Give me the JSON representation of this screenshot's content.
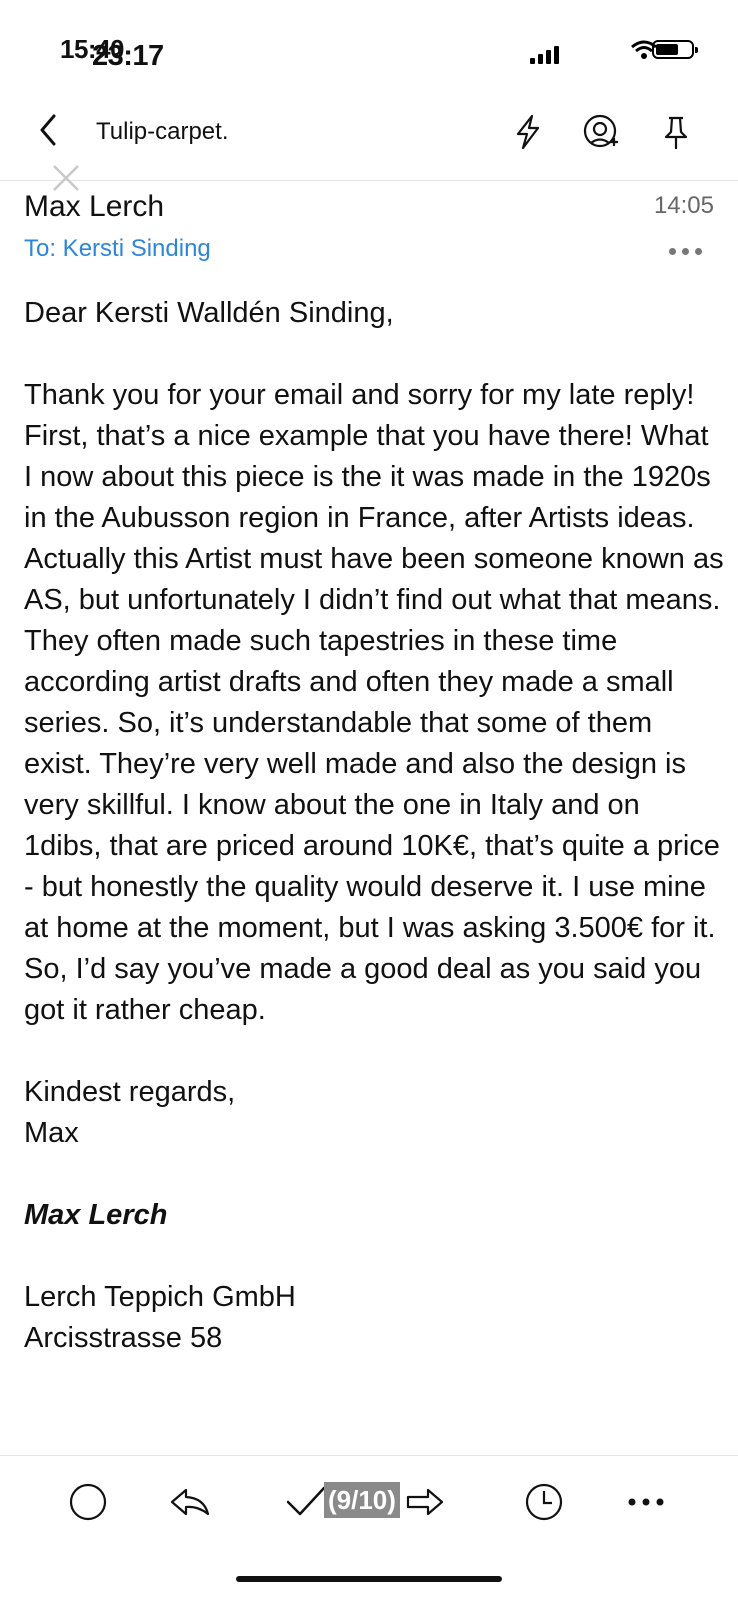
{
  "status_bar": {
    "time_overlap": "15:40",
    "time": "23:17"
  },
  "nav": {
    "title": "Tulip-carpet.",
    "icons": [
      "back-icon",
      "lightning-icon",
      "mention-add-icon",
      "pin-icon"
    ]
  },
  "message": {
    "sender": "Max Lerch",
    "time": "14:05",
    "to": "To: Kersti Sinding",
    "greeting": "Dear Kersti Walldén Sinding,",
    "paragraph": "Thank you for your email and sorry for my late reply! First, that’s a nice example that you have there! What I now about this piece is the it was made in the 1920s in the Aubusson region in France, after Artists ideas. Actually this Artist must have been someone known as AS, but unfortunately I didn’t find out what that means. They often made such tapestries in these time according artist drafts and often they made a small series. So, it’s understandable that some of them exist. They’re very well made and also the design is very skillful. I know about the one in Italy and on 1dibs, that are priced around 10K€, that’s quite a price - but honestly the quality would deserve it. I use mine at home at the moment, but I was asking 3.500€ for it. So, I’d say you’ve made a good deal as you said you got it rather cheap.",
    "closing": "Kindest regards,",
    "closing_name": "Max",
    "signature_name": "Max Lerch",
    "company": "Lerch Teppich GmbH",
    "address": "Arcisstrasse 58"
  },
  "toolbar": {
    "page_counter": "(9/10)",
    "icons": [
      "circle-icon",
      "reply-icon",
      "checkmark-icon",
      "forward-icon",
      "clock-icon",
      "more-icon"
    ]
  }
}
